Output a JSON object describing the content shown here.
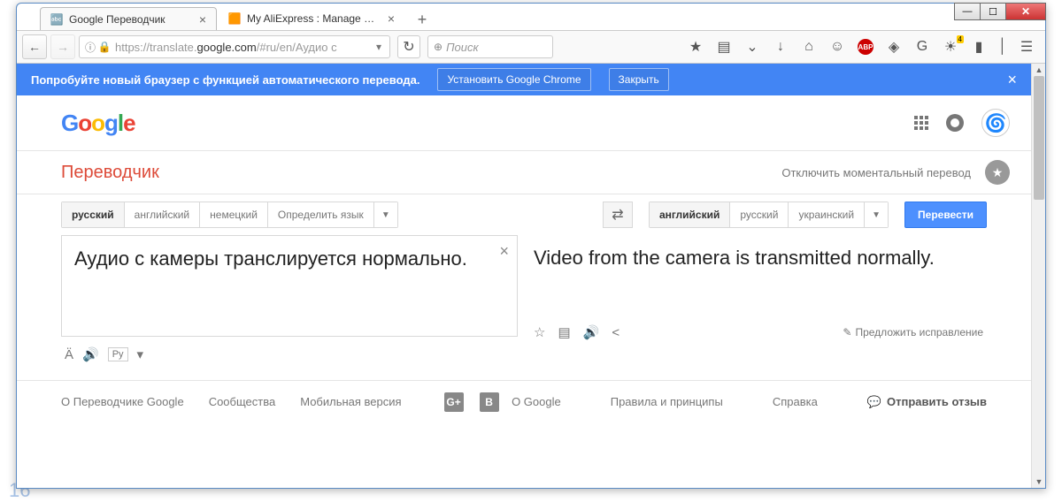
{
  "window_controls": {
    "min": "—",
    "max": "☐",
    "close": "✕"
  },
  "tabs": [
    {
      "title": "Google Переводчик",
      "active": true,
      "favicon": "🔤"
    },
    {
      "title": "My AliExpress : Manage Or...",
      "active": false,
      "favicon": "🟧"
    }
  ],
  "new_tab": "+",
  "nav": {
    "back": "←",
    "forward": "→"
  },
  "url": {
    "info": "ⓘ",
    "lock": "🔒",
    "prefix": "https://",
    "host": "translate.",
    "domain": "google.com",
    "path": "/#ru/en/Аудио с"
  },
  "reload": "↻",
  "search": {
    "icon": "⊕",
    "placeholder": "Поиск"
  },
  "toolbar_icons": {
    "star": "★",
    "reader": "▤",
    "pocket": "⌄",
    "down": "↓",
    "home": "⌂",
    "smile": "☺",
    "abp": "ABP",
    "target": "◈",
    "google": "G",
    "weather": "☀",
    "battery": "▮",
    "menu": "☰",
    "badge": "4"
  },
  "promo": {
    "text": "Попробуйте новый браузер с функцией автоматического перевода.",
    "install": "Установить Google Chrome",
    "close_btn": "Закрыть",
    "x": "×"
  },
  "logo": {
    "G": "G",
    "o1": "o",
    "o2": "o",
    "g": "g",
    "l": "l",
    "e": "e"
  },
  "header": {
    "apps": "",
    "bell": "",
    "avatar": "🌀"
  },
  "app_title": "Переводчик",
  "instant_toggle": "Отключить моментальный перевод",
  "star_icon": "★",
  "src_langs": [
    "русский",
    "английский",
    "немецкий",
    "Определить язык"
  ],
  "src_active": 0,
  "tgt_langs": [
    "английский",
    "русский",
    "украинский"
  ],
  "tgt_active": 0,
  "swap": "⇄",
  "dd": "▼",
  "translate_btn": "Перевести",
  "src_text": "Аудио с камеры транслируется нормально.",
  "clear": "×",
  "src_tools": {
    "char": "Ä",
    "speak": "🔊",
    "input": "Ру",
    "dd": "▾"
  },
  "tgt_text": "Video from the camera is transmitted normally.",
  "tgt_tools": {
    "star": "☆",
    "copy": "▤",
    "speak": "🔊",
    "share": "<"
  },
  "suggest": {
    "icon": "✎",
    "label": "Предложить исправление"
  },
  "footer": {
    "about": "О Переводчике Google",
    "community": "Сообщества",
    "mobile": "Мобильная версия",
    "gplus": "G+",
    "blogger": "B",
    "about_g": "О Google",
    "terms": "Правила и принципы",
    "help": "Справка",
    "feedback_icon": "💬",
    "feedback": "Отправить отзыв"
  },
  "bg_number": "16"
}
